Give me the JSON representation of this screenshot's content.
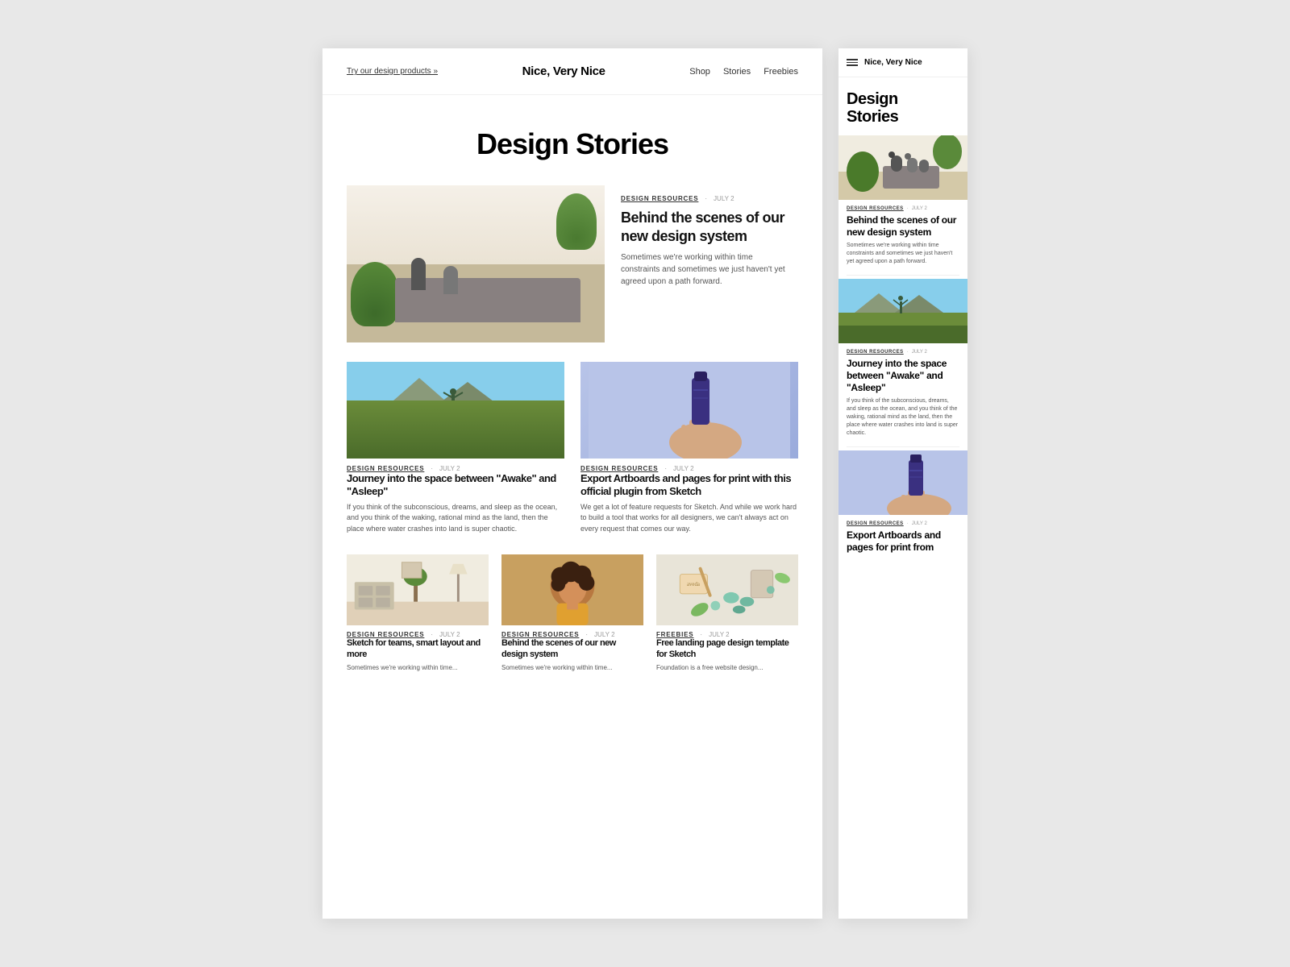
{
  "desktop": {
    "header": {
      "promo_link": "Try our design products »",
      "logo": "Nice, Very Nice",
      "nav": [
        {
          "label": "Shop"
        },
        {
          "label": "Stories"
        },
        {
          "label": "Freebies"
        }
      ]
    },
    "page_title": "Design Stories",
    "featured_article": {
      "category": "DESIGN RESOURCES",
      "date": "JULY 2",
      "title": "Behind the scenes of our new design system",
      "excerpt": "Sometimes we're working within time constraints and sometimes we just haven't yet agreed upon a path forward."
    },
    "grid_articles": [
      {
        "category": "DESIGN RESOURCES",
        "date": "JULY 2",
        "title": "Journey into the space between \"Awake\" and \"Asleep\"",
        "excerpt": "If you think of the subconscious, dreams, and sleep as the ocean, and you think of the waking, rational mind as the land, then the place where water crashes into land is super chaotic.",
        "image_type": "field"
      },
      {
        "category": "DESIGN RESOURCES",
        "date": "JULY 2",
        "title": "Export Artboards and pages for print with this official plugin from Sketch",
        "excerpt": "We get a lot of feature requests for Sketch. And while we work hard to build a tool that works for all designers, we can't always act on every request that comes our way.",
        "image_type": "hand-product"
      }
    ],
    "row_articles": [
      {
        "category": "DESIGN RESOURCES",
        "date": "JULY 2",
        "title": "Sketch for teams, smart layout and more",
        "excerpt": "Sometimes we're working within time...",
        "image_type": "interior"
      },
      {
        "category": "DESIGN RESOURCES",
        "date": "JULY 2",
        "title": "Behind the scenes of our new design system",
        "excerpt": "Sometimes we're working within time...",
        "image_type": "portrait"
      },
      {
        "category": "FREEBIES",
        "date": "JULY 2",
        "title": "Free landing page design template for Sketch",
        "excerpt": "Foundation is a free website design...",
        "image_type": "flatlay"
      }
    ]
  },
  "mobile": {
    "header": {
      "logo": "Nice, Very Nice"
    },
    "page_title": "Design\nStories",
    "featured_article": {
      "category": "DESIGN RESOURCES",
      "date": "JULY 2",
      "title": "Behind the scenes of our new design system",
      "excerpt": "Sometimes we're working within time constraints and sometimes we just haven't yet agreed upon a path forward."
    },
    "secondary_article": {
      "category": "DESIGN RESOURCES",
      "date": "JULY 2",
      "title": "Journey into the space between \"Awake\" and \"Asleep\"",
      "excerpt": "If you think of the subconscious, dreams, and sleep as the ocean, and you think of the waking, rational mind as the land, then the place where water crashes into land is super chaotic."
    },
    "third_article": {
      "category": "DESIGN RESOURCES",
      "date": "JULY 2",
      "title": "Export Artboards and pages for print from",
      "excerpt": ""
    }
  }
}
